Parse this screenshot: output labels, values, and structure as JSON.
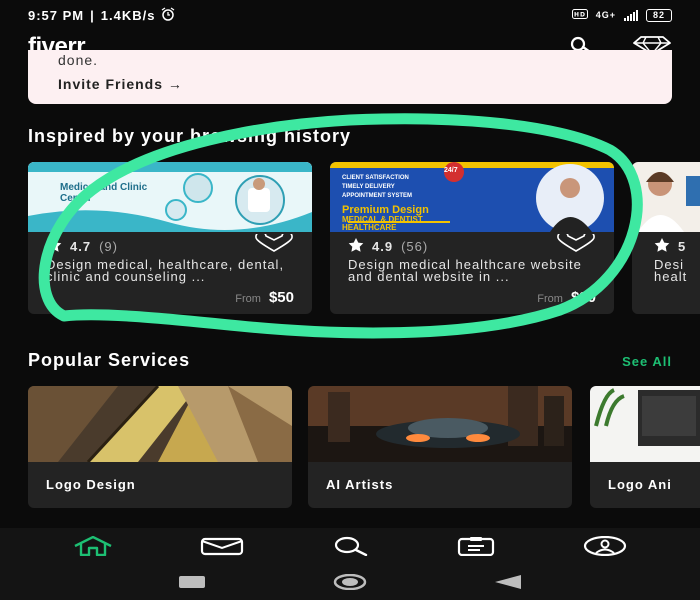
{
  "status": {
    "time": "9:57 PM",
    "speed": "1.4KB/s",
    "network": "4G+",
    "battery": "82"
  },
  "app": {
    "logo_text": "fiverr",
    "logo_dot": "."
  },
  "invite": {
    "done_text": "done.",
    "link": "Invite Friends →"
  },
  "sections": {
    "inspired": "Inspired by your browsing history",
    "popular": "Popular Services",
    "see_all": "See All"
  },
  "gigs": [
    {
      "rating": "4.7",
      "count": "(9)",
      "desc": "Design medical, healthcare, dental, clinic and counseling ...",
      "from": "From",
      "price": "$50",
      "thumb_title": "Medical and Clinic Center"
    },
    {
      "rating": "4.9",
      "count": "(56)",
      "desc": "Design medical healthcare website and dental website in ...",
      "from": "From",
      "price": "$80",
      "thumb_lines": [
        "CLIENT SATISFACTION",
        "TIMELY DELIVERY",
        "APPOINTMENT SYSTEM"
      ],
      "thumb_title": "Premium Design",
      "thumb_sub1": "MEDICAL & DENTIST",
      "thumb_sub2": "HEALTHCARE",
      "badge": "24/7"
    },
    {
      "rating": "5",
      "desc_lines": [
        "Desi",
        "healt"
      ]
    }
  ],
  "services": [
    {
      "label": "Logo Design"
    },
    {
      "label": "AI Artists"
    },
    {
      "label": "Logo Ani"
    }
  ],
  "colors": {
    "accent": "#1dbf73",
    "highlight": "#3ee8a1",
    "background": "#0b0b0b",
    "card": "#232323"
  },
  "icons": [
    "home-icon",
    "messages-icon",
    "search-icon",
    "orders-icon",
    "profile-icon",
    "diamond-icon"
  ]
}
